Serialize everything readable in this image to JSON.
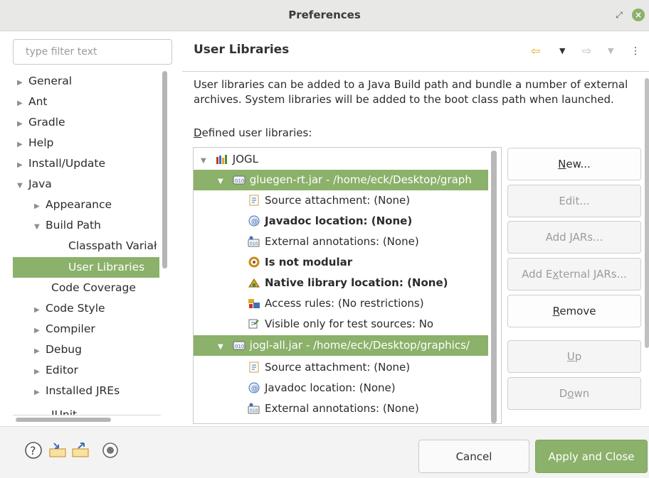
{
  "window": {
    "title": "Preferences"
  },
  "filter": {
    "placeholder": "type filter text"
  },
  "tree": {
    "items": [
      {
        "label": "General"
      },
      {
        "label": "Ant"
      },
      {
        "label": "Gradle"
      },
      {
        "label": "Help"
      },
      {
        "label": "Install/Update"
      },
      {
        "label": "Java"
      },
      {
        "label": "Appearance"
      },
      {
        "label": "Build Path"
      },
      {
        "label": "Classpath Variał"
      },
      {
        "label": "User Libraries"
      },
      {
        "label": "Code Coverage"
      },
      {
        "label": "Code Style"
      },
      {
        "label": "Compiler"
      },
      {
        "label": "Debug"
      },
      {
        "label": "Editor"
      },
      {
        "label": "Installed JREs"
      },
      {
        "label": "JUnit"
      }
    ]
  },
  "panel": {
    "title": "User Libraries",
    "description": "User libraries can be added to a Java Build path and bundle a number of external archives. System libraries will be added to the boot class path when launched.",
    "defined_label_underlined": "D",
    "defined_label_rest": "efined user libraries:"
  },
  "libraries": {
    "rows": [
      {
        "label": "JOGL",
        "icon": "library-icon"
      },
      {
        "label": "gluegen-rt.jar - /home/eck/Desktop/graph",
        "icon": "jar-icon"
      },
      {
        "prefix": "Source attachment: ",
        "value": "(None)",
        "icon": "source-attachment-icon"
      },
      {
        "prefix": "Javadoc location: ",
        "value": "(None)",
        "icon": "javadoc-icon"
      },
      {
        "prefix": "External annotations: ",
        "value": "(None)",
        "icon": "annotations-icon"
      },
      {
        "prefix": "Is not modular",
        "value": "",
        "icon": "module-icon"
      },
      {
        "prefix": "Native library location: ",
        "value": "(None)",
        "icon": "native-library-icon"
      },
      {
        "prefix": "Access rules: ",
        "value": "(No restrictions)",
        "icon": "access-rules-icon"
      },
      {
        "prefix": "Visible only for test sources: ",
        "value": "No",
        "icon": "test-sources-icon"
      },
      {
        "label": "jogl-all.jar - /home/eck/Desktop/graphics/",
        "icon": "jar-icon"
      },
      {
        "prefix": "Source attachment: ",
        "value": "(None)",
        "icon": "source-attachment-icon"
      },
      {
        "prefix": "Javadoc location: ",
        "value": "(None)",
        "icon": "javadoc-icon"
      },
      {
        "prefix": "External annotations: ",
        "value": "(None)",
        "icon": "annotations-icon"
      }
    ]
  },
  "buttons": {
    "new_u": "N",
    "new_rest": "ew...",
    "edit": "Edit...",
    "add_jars_pre": "Add ",
    "add_jars_u": "J",
    "add_jars_rest": "ARs...",
    "add_ext_pre": "Add E",
    "add_ext_u": "x",
    "add_ext_rest": "ternal JARs...",
    "remove_u": "R",
    "remove_rest": "emove",
    "up_u": "U",
    "up_rest": "p",
    "down_pre": "D",
    "down_u": "o",
    "down_rest": "wn"
  },
  "footer": {
    "cancel": "Cancel",
    "apply": "Apply and Close"
  },
  "colors": {
    "accent": "#8bb16a",
    "nav_arrow": "#e8a317"
  }
}
